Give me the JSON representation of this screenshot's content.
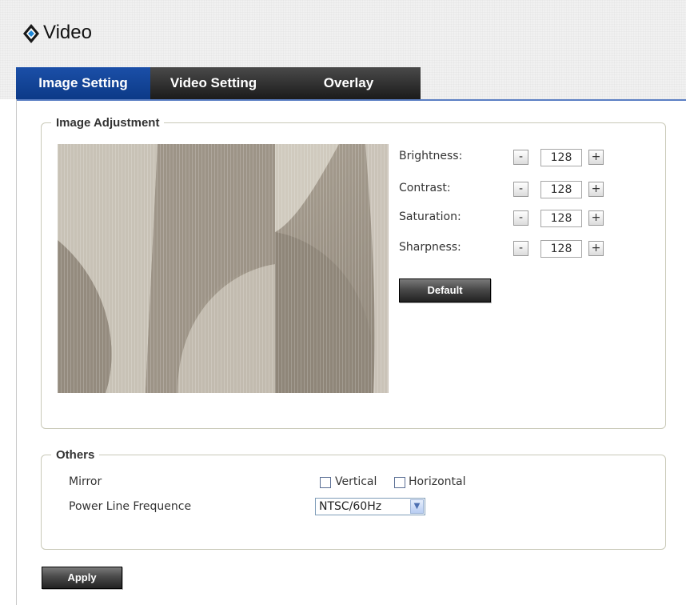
{
  "app": {
    "title": "Video"
  },
  "tabs": [
    {
      "label": "Image Setting",
      "active": true
    },
    {
      "label": "Video Setting",
      "active": false
    },
    {
      "label": "Overlay",
      "active": false
    }
  ],
  "image_adjustment": {
    "legend": "Image Adjustment",
    "controls": [
      {
        "label": "Brightness:",
        "value": "128",
        "minus": "-",
        "plus": "+"
      },
      {
        "label": "Contrast:",
        "value": "128",
        "minus": "-",
        "plus": "+"
      },
      {
        "label": "Saturation:",
        "value": "128",
        "minus": "-",
        "plus": "+"
      },
      {
        "label": "Sharpness:",
        "value": "128",
        "minus": "-",
        "plus": "+"
      }
    ],
    "default_label": "Default"
  },
  "others": {
    "legend": "Others",
    "mirror_label": "Mirror",
    "mirror_options": [
      {
        "label": "Vertical",
        "checked": false
      },
      {
        "label": "Horizontal",
        "checked": false
      }
    ],
    "power_line_label": "Power Line Frequence",
    "power_line_value": "NTSC/60Hz"
  },
  "apply_label": "Apply",
  "colors": {
    "active_tab": "#0c3a87",
    "inactive_tab": "#1b1b1b",
    "accent_line": "#5b7fc4",
    "box_border": "#c9c9b8"
  }
}
